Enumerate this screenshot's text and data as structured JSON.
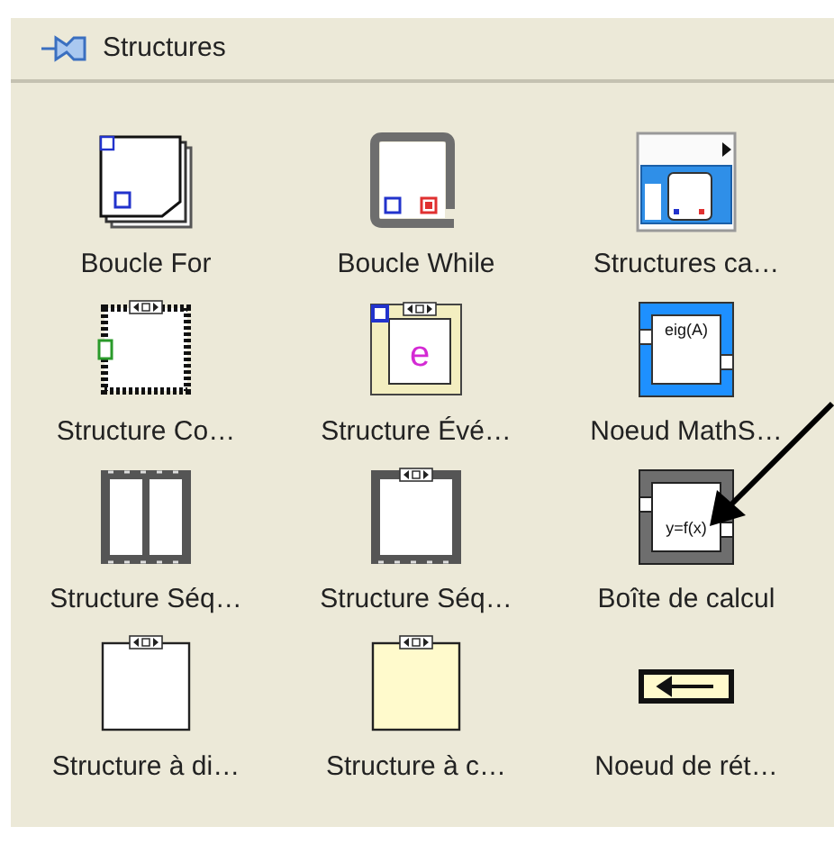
{
  "palette": {
    "title": "Structures"
  },
  "items": [
    {
      "label": "Boucle For",
      "kind": "for_loop"
    },
    {
      "label": "Boucle While",
      "kind": "while_loop"
    },
    {
      "label": "Structures ca…",
      "kind": "timed"
    },
    {
      "label": "Structure Co…",
      "kind": "case"
    },
    {
      "label": "Structure Évé…",
      "kind": "event",
      "icon_text": "e"
    },
    {
      "label": "Noeud MathS…",
      "kind": "mathscript",
      "icon_text": "eig(A)"
    },
    {
      "label": "Structure Séq…",
      "kind": "flat_sequence"
    },
    {
      "label": "Structure Séq…",
      "kind": "stacked_sequence"
    },
    {
      "label": "Boîte de calcul",
      "kind": "formula",
      "icon_text": "y=f(x)"
    },
    {
      "label": "Structure à di…",
      "kind": "diagram_disable"
    },
    {
      "label": "Structure à c…",
      "kind": "conditional_disable"
    },
    {
      "label": "Noeud de rét…",
      "kind": "feedback"
    }
  ]
}
